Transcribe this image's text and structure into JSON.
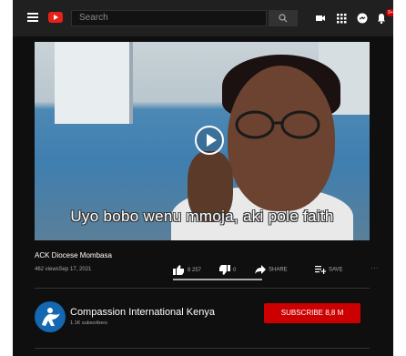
{
  "topbar": {
    "search_placeholder": "Search",
    "notification_count": "9+"
  },
  "video": {
    "caption": "Uyo bobo wenu mmoja, aki pole faith",
    "title": "ACK Diocese Mombasa",
    "meta": "462 viewsSep 17, 2021",
    "likes": "8 257",
    "dislikes": "0",
    "share_label": "SHARE",
    "save_label": "SAVE",
    "more_label": "..."
  },
  "channel": {
    "name": "Compassion International Kenya",
    "subscribers": "1.1K subscribers",
    "subscribe_label": "SUBSCRIBE  8,8 M"
  },
  "colors": {
    "background": "#0f0f0f",
    "topbar": "#202020",
    "brand_red": "#cc0000",
    "avatar_blue": "#1467b0"
  }
}
